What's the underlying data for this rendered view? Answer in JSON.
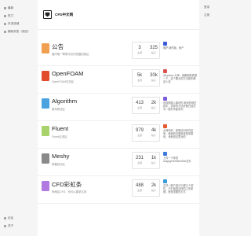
{
  "sidebar": {
    "top_items": [
      {
        "label": "最新"
      },
      {
        "label": "热门"
      },
      {
        "label": "东流流域"
      },
      {
        "label": "随机浏览（测试）"
      }
    ],
    "bottom_items": [
      {
        "label": "论坛"
      },
      {
        "label": "关于"
      }
    ]
  },
  "header": {
    "site_title": "CFD中文网"
  },
  "right_links": [
    {
      "label": "登录"
    },
    {
      "label": "注册"
    }
  ],
  "forums": [
    {
      "name": "公告",
      "desc": "版内唯一帮助可访问范围的版区",
      "icon_color": "#f0a050",
      "icon_glyph": "",
      "topics": "3",
      "posts": "325",
      "topics_label": "主题",
      "posts_label": "帖子",
      "avatar_color": "#3a5bd9",
      "last_post": "维护 新的版、帐户"
    },
    {
      "name": "OpenFOAM",
      "desc": "OpenFOAM交流区",
      "icon_color": "#e24c2c",
      "icon_glyph": "",
      "topics": "5k",
      "posts": "30k",
      "topics_label": "主题",
      "posts_label": "帖子",
      "avatar_color": "#d9534f",
      "last_post": "@kpulsur 大师，我刚刚查看提一下，这个要点的方法基本都这么说"
    },
    {
      "name": "Algorithm",
      "desc": "基本算法区",
      "icon_color": "#4aa3df",
      "icon_glyph": "",
      "topics": "413",
      "posts": "2k",
      "topics_label": "主题",
      "posts_label": "帖子",
      "avatar_color": "#7b5bd9",
      "last_post": "也按照插入模块的 看到的现在其中，这样的方法好像已经在中一般对不起系列"
    },
    {
      "name": "Fluent",
      "desc": "Fluent交流区",
      "icon_color": "#a8d26a",
      "icon_glyph": "",
      "topics": "979",
      "posts": "4k",
      "topics_label": "主题",
      "posts_label": "帖子",
      "avatar_color": "#e65a2f",
      "last_post": "大师你好，我想请问你们这条，像我的问题就是相关模块，也就是这里对的"
    },
    {
      "name": "Meshy",
      "desc": "网格划分区",
      "icon_color": "#8a8a8a",
      "icon_glyph": "",
      "topics": "231",
      "posts": "1k",
      "topics_label": "主题",
      "posts_label": "帖子",
      "avatar_color": "#3a7bd9",
      "last_post": "上传一下你的snappyHexMeshDict文件"
    },
    {
      "name": "CFD彩虹条",
      "desc": "有两区CFD，也可以要求达到",
      "icon_color": "#b07ae0",
      "icon_glyph": "",
      "topics": "488",
      "posts": "2k",
      "topics_label": "主题",
      "posts_label": "帖子",
      "avatar_color": "#3a9bd9",
      "last_post": "正好一般介绍CFD那几个软件，它们就是这样的工作原理，就是重要的方式"
    }
  ]
}
